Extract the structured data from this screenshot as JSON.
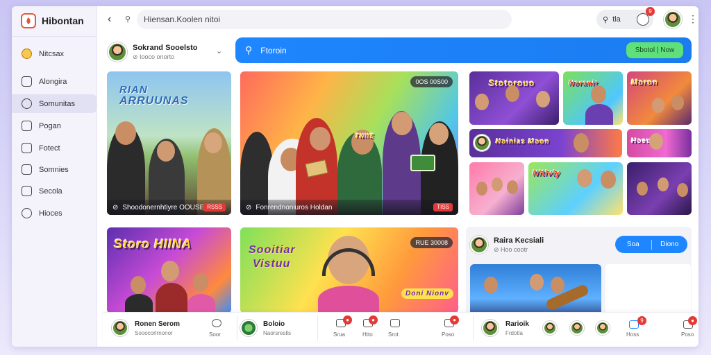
{
  "app": {
    "name": "Hibontan"
  },
  "sidebar": {
    "items": [
      {
        "label": "Nitcsax",
        "icon": "coin-icon"
      },
      {
        "label": "Alongira",
        "icon": "home-icon"
      },
      {
        "label": "Somunitas",
        "icon": "community-icon"
      },
      {
        "label": "Pogan",
        "icon": "page-icon"
      },
      {
        "label": "Fotect",
        "icon": "photo-icon"
      },
      {
        "label": "Somnies",
        "icon": "calendar-icon"
      },
      {
        "label": "Secola",
        "icon": "grid-icon"
      },
      {
        "label": "Hioces",
        "icon": "help-icon"
      }
    ]
  },
  "topbar": {
    "back": "‹",
    "search_icon": "⚲",
    "url": "Hiensan.Koolen nitoi",
    "pill_label": "tla",
    "pill_icon": "⚲",
    "notif_count": "9",
    "menu": "⋮"
  },
  "profile": {
    "name": "Sokrand Sooelsto",
    "sub": "⊘ Iooco onorto"
  },
  "blue_search": {
    "label": "Ftoroin",
    "button": "Sbotol | Now"
  },
  "cards": {
    "c1": {
      "title_a": "RIAN",
      "title_b": "ARRUUNAS",
      "caption": "Shoodonernhtiyre OOUSE",
      "tag": "RSSS"
    },
    "c2": {
      "top_tag": "0OS 00S00",
      "caption": "Fonrendnoniuros Holdan",
      "tag": "TISS",
      "sign": "TNIIE"
    },
    "c3": {
      "title": "Stotorouo"
    },
    "c4": {
      "title": "Noranir"
    },
    "c5": {
      "title": "Moron"
    },
    "c6": {
      "title": "Noinias Moon"
    },
    "c7": {
      "title": "Hoeu"
    },
    "c8": {
      "title": "Nitiviy"
    },
    "c9": {
      "title": "Storo HIINA"
    },
    "c10": {
      "title_a": "Sooitiar",
      "title_b": "Vi⁠stuu",
      "sign": "Doni Nionv",
      "tag": "RUE 30008"
    }
  },
  "right_panel": {
    "name": "Raira Kecsiali",
    "sub": "⊘ Hoo cootr",
    "pill_left": "Soa",
    "pill_right": "Diono"
  },
  "bottom": {
    "a": {
      "name": "Ronen Serom",
      "sub": "Sooocorlrnonor",
      "label": "Soor"
    },
    "b": {
      "name": "Boloio",
      "sub": "Naorsreslls"
    },
    "items": [
      {
        "label": "Srua",
        "badge": ""
      },
      {
        "label": "Htto",
        "badge": ""
      },
      {
        "label": "Srot",
        "badge": ""
      },
      {
        "label": "Poso",
        "badge": ""
      }
    ],
    "c": {
      "name": "Rarioik",
      "sub": "Frdotla"
    },
    "d_label": "Hoss",
    "d_badge": "9",
    "e_label": "Poso"
  },
  "colors": {
    "accent": "#1e86ff",
    "success": "#5fe07a",
    "alert": "#e53935"
  }
}
